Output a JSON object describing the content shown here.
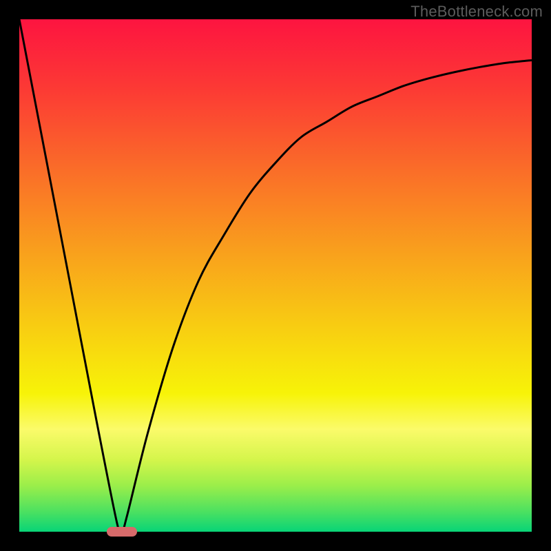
{
  "watermark": "TheBottleneck.com",
  "colors": {
    "frame": "#000000",
    "watermark": "#5c5c5c",
    "curve": "#000000",
    "marker": "#d66a6a",
    "gradient_stops": [
      {
        "offset": 0.0,
        "color": "#fd1440"
      },
      {
        "offset": 0.14,
        "color": "#fc3b34"
      },
      {
        "offset": 0.3,
        "color": "#fa6f28"
      },
      {
        "offset": 0.46,
        "color": "#f9a21c"
      },
      {
        "offset": 0.6,
        "color": "#f8cd12"
      },
      {
        "offset": 0.73,
        "color": "#f7f308"
      },
      {
        "offset": 0.8,
        "color": "#fbfb6a"
      },
      {
        "offset": 0.86,
        "color": "#d4f54b"
      },
      {
        "offset": 0.91,
        "color": "#9bee4a"
      },
      {
        "offset": 0.96,
        "color": "#4de160"
      },
      {
        "offset": 1.0,
        "color": "#08d477"
      }
    ]
  },
  "chart_data": {
    "type": "line",
    "title": "",
    "xlabel": "",
    "ylabel": "",
    "ylim": [
      0,
      100
    ],
    "xlim": [
      0,
      100
    ],
    "x": [
      0,
      5,
      10,
      15,
      19,
      20,
      21,
      25,
      30,
      35,
      40,
      45,
      50,
      55,
      60,
      65,
      70,
      75,
      80,
      85,
      90,
      95,
      100
    ],
    "values": [
      100,
      74,
      48,
      22,
      2,
      0,
      3,
      19,
      36,
      49,
      58,
      66,
      72,
      77,
      80,
      83,
      85,
      87,
      88.5,
      89.7,
      90.7,
      91.5,
      92
    ],
    "marker_x": 20,
    "marker_y": 0,
    "notes": "x and values are normalized 0-100; curve = |bottleneck %| style plot, minimum at x≈20."
  },
  "layout": {
    "image_size": 800,
    "plot_inset": 28,
    "marker_px": {
      "w": 44,
      "h": 14
    }
  }
}
